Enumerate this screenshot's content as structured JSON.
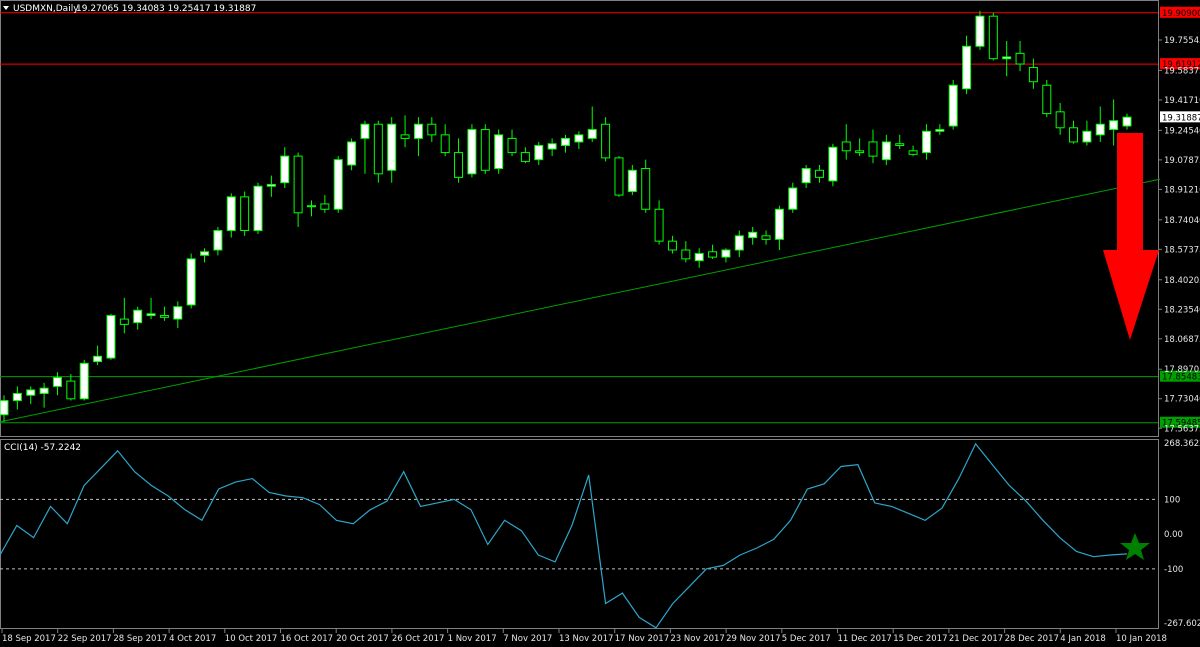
{
  "header": {
    "symbol": "USDMXN,Daily",
    "ohlc": "19.27065 19.34083 19.25417 19.31887"
  },
  "indicator": {
    "label": "CCI(14) -57.2242",
    "scale_labels": [
      "268.3622",
      "100",
      "0.00",
      "-100",
      "-267.6026"
    ]
  },
  "price_axis": {
    "ticks": [
      "19.75545",
      "19.58375",
      "19.41710",
      "19.24540",
      "19.07875",
      "18.91210",
      "18.74040",
      "18.57375",
      "18.40205",
      "18.23540",
      "18.06875",
      "17.89705",
      "17.73040",
      "17.56375"
    ],
    "current_price": "19.31887",
    "levels": [
      {
        "value": "19.90900",
        "color": "#ff0000"
      },
      {
        "value": "19.61912",
        "color": "#ff0000"
      },
      {
        "value": "17.85483",
        "color": "#00a000"
      },
      {
        "value": "17.59485",
        "color": "#00a000"
      }
    ]
  },
  "time_axis": [
    "18 Sep 2017",
    "22 Sep 2017",
    "28 Sep 2017",
    "4 Oct 2017",
    "10 Oct 2017",
    "16 Oct 2017",
    "20 Oct 2017",
    "26 Oct 2017",
    "1 Nov 2017",
    "7 Nov 2017",
    "13 Nov 2017",
    "17 Nov 2017",
    "23 Nov 2017",
    "29 Nov 2017",
    "5 Dec 2017",
    "11 Dec 2017",
    "15 Dec 2017",
    "21 Dec 2017",
    "28 Dec 2017",
    "4 Jan 2018",
    "10 Jan 2018"
  ],
  "colors": {
    "bull": "#ffffff",
    "bear": "#000000",
    "wick": "#00ff00",
    "cci": "#2ea6c9",
    "trend": "#00a000",
    "arrow": "#ff0000",
    "star": "#008000"
  },
  "chart_data": {
    "type": "candlestick",
    "ylim": [
      17.52,
      19.97
    ],
    "candles": [
      [
        17.64,
        17.75,
        17.6,
        17.72
      ],
      [
        17.72,
        17.8,
        17.67,
        17.76
      ],
      [
        17.75,
        17.8,
        17.7,
        17.78
      ],
      [
        17.76,
        17.82,
        17.68,
        17.79
      ],
      [
        17.8,
        17.88,
        17.75,
        17.85
      ],
      [
        17.83,
        17.87,
        17.72,
        17.73
      ],
      [
        17.73,
        17.95,
        17.72,
        17.93
      ],
      [
        17.94,
        18.03,
        17.92,
        17.97
      ],
      [
        17.96,
        18.21,
        17.95,
        18.2
      ],
      [
        18.18,
        18.3,
        18.1,
        18.15
      ],
      [
        18.16,
        18.25,
        18.12,
        18.23
      ],
      [
        18.2,
        18.3,
        18.18,
        18.21
      ],
      [
        18.2,
        18.25,
        18.17,
        18.19
      ],
      [
        18.18,
        18.28,
        18.13,
        18.25
      ],
      [
        18.26,
        18.55,
        18.24,
        18.52
      ],
      [
        18.54,
        18.58,
        18.5,
        18.56
      ],
      [
        18.57,
        18.7,
        18.54,
        18.68
      ],
      [
        18.68,
        18.89,
        18.64,
        18.87
      ],
      [
        18.87,
        18.9,
        18.65,
        18.68
      ],
      [
        18.68,
        18.95,
        18.66,
        18.93
      ],
      [
        18.93,
        18.99,
        18.87,
        18.94
      ],
      [
        18.95,
        19.15,
        18.92,
        19.1
      ],
      [
        19.1,
        19.12,
        18.7,
        18.78
      ],
      [
        18.82,
        18.85,
        18.76,
        18.82
      ],
      [
        18.83,
        18.88,
        18.78,
        18.8
      ],
      [
        18.8,
        19.1,
        18.78,
        19.08
      ],
      [
        19.05,
        19.2,
        19.02,
        19.18
      ],
      [
        19.2,
        19.3,
        19.0,
        19.28
      ],
      [
        19.28,
        19.3,
        18.95,
        19.0
      ],
      [
        19.02,
        19.32,
        18.95,
        19.28
      ],
      [
        19.22,
        19.33,
        19.15,
        19.2
      ],
      [
        19.2,
        19.32,
        19.1,
        19.28
      ],
      [
        19.28,
        19.32,
        19.18,
        19.22
      ],
      [
        19.22,
        19.28,
        19.1,
        19.12
      ],
      [
        19.12,
        19.2,
        18.95,
        18.98
      ],
      [
        19.0,
        19.28,
        18.98,
        19.25
      ],
      [
        19.25,
        19.28,
        19.0,
        19.02
      ],
      [
        19.03,
        19.25,
        19.0,
        19.22
      ],
      [
        19.2,
        19.25,
        19.1,
        19.12
      ],
      [
        19.12,
        19.15,
        19.06,
        19.07
      ],
      [
        19.08,
        19.18,
        19.05,
        19.16
      ],
      [
        19.14,
        19.2,
        19.1,
        19.17
      ],
      [
        19.16,
        19.22,
        19.12,
        19.2
      ],
      [
        19.18,
        19.24,
        19.14,
        19.22
      ],
      [
        19.2,
        19.38,
        19.18,
        19.25
      ],
      [
        19.28,
        19.32,
        19.07,
        19.09
      ],
      [
        19.09,
        19.1,
        18.87,
        18.88
      ],
      [
        18.9,
        19.05,
        18.88,
        19.02
      ],
      [
        19.03,
        19.08,
        18.78,
        18.8
      ],
      [
        18.8,
        18.85,
        18.6,
        18.62
      ],
      [
        18.62,
        18.65,
        18.55,
        18.57
      ],
      [
        18.57,
        18.62,
        18.5,
        18.52
      ],
      [
        18.51,
        18.58,
        18.47,
        18.55
      ],
      [
        18.56,
        18.6,
        18.52,
        18.53
      ],
      [
        18.53,
        18.58,
        18.5,
        18.57
      ],
      [
        18.57,
        18.68,
        18.53,
        18.65
      ],
      [
        18.64,
        18.7,
        18.6,
        18.67
      ],
      [
        18.65,
        18.68,
        18.6,
        18.63
      ],
      [
        18.63,
        18.82,
        18.57,
        18.8
      ],
      [
        18.8,
        18.95,
        18.78,
        18.92
      ],
      [
        18.95,
        19.05,
        18.92,
        19.03
      ],
      [
        19.02,
        19.05,
        18.95,
        18.98
      ],
      [
        18.96,
        19.17,
        18.93,
        19.15
      ],
      [
        19.18,
        19.28,
        19.08,
        19.13
      ],
      [
        19.13,
        19.2,
        19.1,
        19.12
      ],
      [
        19.18,
        19.25,
        19.06,
        19.1
      ],
      [
        19.08,
        19.22,
        19.05,
        19.18
      ],
      [
        19.17,
        19.22,
        19.14,
        19.16
      ],
      [
        19.13,
        19.16,
        19.1,
        19.11
      ],
      [
        19.12,
        19.28,
        19.08,
        19.24
      ],
      [
        19.24,
        19.28,
        19.22,
        19.25
      ],
      [
        19.27,
        19.53,
        19.25,
        19.5
      ],
      [
        19.48,
        19.78,
        19.45,
        19.72
      ],
      [
        19.72,
        19.92,
        19.7,
        19.89
      ],
      [
        19.89,
        19.91,
        19.64,
        19.65
      ],
      [
        19.65,
        19.75,
        19.55,
        19.66
      ],
      [
        19.68,
        19.75,
        19.58,
        19.62
      ],
      [
        19.6,
        19.65,
        19.48,
        19.52
      ],
      [
        19.5,
        19.53,
        19.32,
        19.34
      ],
      [
        19.35,
        19.4,
        19.22,
        19.26
      ],
      [
        19.26,
        19.3,
        19.17,
        19.18
      ],
      [
        19.18,
        19.3,
        19.16,
        19.24
      ],
      [
        19.22,
        19.38,
        19.18,
        19.28
      ],
      [
        19.25,
        19.42,
        19.16,
        19.3
      ],
      [
        19.27,
        19.34,
        19.25,
        19.32
      ]
    ],
    "trendline": [
      [
        0,
        17.6
      ],
      [
        1160,
        18.97
      ]
    ],
    "cci": [
      -60,
      25,
      -10,
      80,
      30,
      140,
      190,
      240,
      180,
      140,
      110,
      70,
      40,
      130,
      150,
      160,
      120,
      110,
      105,
      85,
      40,
      30,
      70,
      95,
      180,
      80,
      90,
      100,
      70,
      -30,
      40,
      10,
      -60,
      -80,
      25,
      170,
      -200,
      -170,
      -240,
      -270,
      -200,
      -150,
      -100,
      -90,
      -60,
      -40,
      -15,
      40,
      130,
      145,
      195,
      200,
      90,
      80,
      60,
      40,
      75,
      160,
      260,
      200,
      140,
      95,
      40,
      -10,
      -50,
      -65,
      -60,
      -57
    ]
  }
}
